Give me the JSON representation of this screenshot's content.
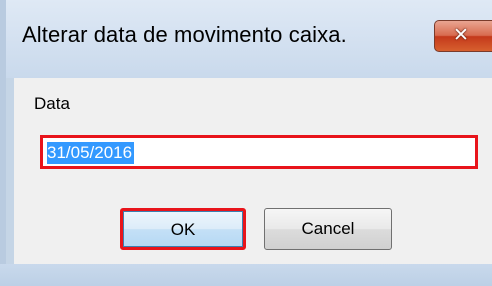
{
  "window": {
    "title": "Alterar data de movimento caixa.",
    "close_icon": "close-icon"
  },
  "form": {
    "date_label": "Data",
    "date_value": "31/05/2016"
  },
  "buttons": {
    "ok_label": "OK",
    "cancel_label": "Cancel"
  },
  "colors": {
    "highlight_border": "#e8141b",
    "selection": "#3399ff"
  }
}
